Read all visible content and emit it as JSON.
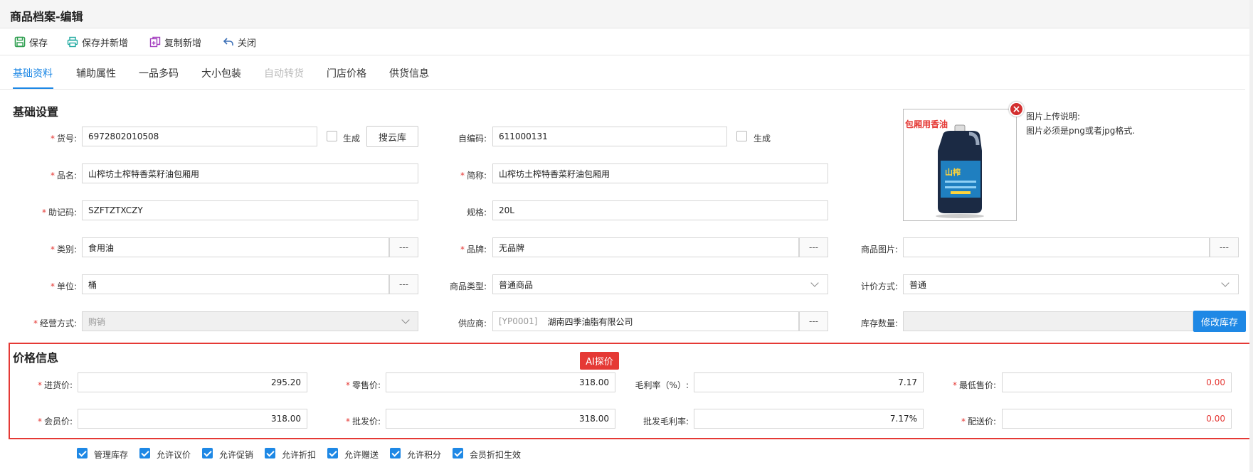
{
  "page": {
    "title": "商品档案-编辑"
  },
  "toolbar": {
    "save": "保存",
    "save_new": "保存并新增",
    "copy_new": "复制新增",
    "close": "关闭"
  },
  "tabs": [
    "基础资料",
    "辅助属性",
    "一品多码",
    "大小包装",
    "自动转货",
    "门店价格",
    "供货信息"
  ],
  "basic": {
    "section_title": "基础设置",
    "huohao": {
      "label": "货号:",
      "value": "6972802010508"
    },
    "generate1": "生成",
    "search_cloud": "搜云库",
    "zibianma": {
      "label": "自编码:",
      "value": "611000131"
    },
    "generate2": "生成",
    "pinming": {
      "label": "品名:",
      "value": "山榨坊土榨特香菜籽油包厢用"
    },
    "jiancheng": {
      "label": "简称:",
      "value": "山榨坊土榨特香菜籽油包厢用"
    },
    "zhujima": {
      "label": "助记码:",
      "value": "SZFTZTXCZY"
    },
    "guige": {
      "label": "规格:",
      "value": "20L"
    },
    "leibie": {
      "label": "类别:",
      "value": "食用油"
    },
    "pinpai": {
      "label": "品牌:",
      "value": "无品牌"
    },
    "shangpin_tupian": {
      "label": "商品图片:",
      "value": ""
    },
    "danwei": {
      "label": "单位:",
      "value": "桶"
    },
    "shangpin_leixing": {
      "label": "商品类型:",
      "value": "普通商品"
    },
    "jijia_fangshi": {
      "label": "计价方式:",
      "value": "普通"
    },
    "jingying_fangshi": {
      "label": "经营方式:",
      "value": "购销"
    },
    "gongyingshang": {
      "label": "供应商:",
      "code": "[YP0001]",
      "value": "湖南四季油脂有限公司"
    },
    "kucun_shuliang": {
      "label": "库存数量:",
      "value": ""
    },
    "modify_stock": "修改库存",
    "dots": "---"
  },
  "image": {
    "caption": "包厢用香油",
    "note_title": "图片上传说明:",
    "note_body": "图片必须是png或者jpg格式."
  },
  "price": {
    "section_title": "价格信息",
    "ai_button": "AI探价",
    "jinhuojia": {
      "label": "进货价:",
      "value": "295.20"
    },
    "lingshoujia": {
      "label": "零售价:",
      "value": "318.00"
    },
    "maolilv": {
      "label": "毛利率（%）:",
      "value": "7.17"
    },
    "zuidi_shoujia": {
      "label": "最低售价:",
      "value": "0.00"
    },
    "huiyuanjia": {
      "label": "会员价:",
      "value": "318.00"
    },
    "pifajia": {
      "label": "批发价:",
      "value": "318.00"
    },
    "pifa_maolilv": {
      "label": "批发毛利率:",
      "value": "7.17%"
    },
    "peisongjia": {
      "label": "配送价:",
      "value": "0.00"
    }
  },
  "options": [
    "管理库存",
    "允许议价",
    "允许促销",
    "允许折扣",
    "允许赠送",
    "允许积分",
    "会员折扣生效"
  ],
  "colors": {
    "accent": "#1e88e5",
    "danger": "#e53935"
  }
}
